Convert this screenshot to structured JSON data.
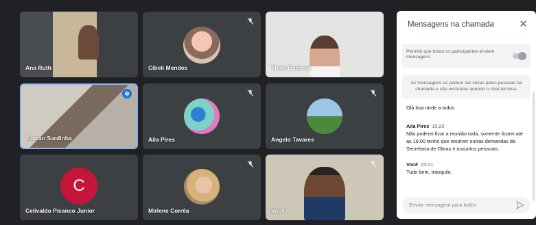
{
  "participants": [
    {
      "name": "Ana Ruth",
      "muted": false
    },
    {
      "name": "Cibeli Mendes",
      "muted": true
    },
    {
      "name": "Thais Barbosa",
      "muted": false
    },
    {
      "name": "Lorran Sardinha",
      "muted": false,
      "speaking": true
    },
    {
      "name": "Aila Pires",
      "muted": true
    },
    {
      "name": "Angelo Tavares",
      "muted": true
    },
    {
      "name": "Celivaldo Picanco Junior",
      "muted": false,
      "initial": "C"
    },
    {
      "name": "Mirlene Corrêa",
      "muted": true
    },
    {
      "name": "Você",
      "muted": true
    }
  ],
  "chat": {
    "title": "Mensagens na chamada",
    "allow_label": "Permitir que todos os participantes enviem mensagens",
    "info": "As mensagens só podem ser vistas pelas pessoas na chamada e são excluídas quando o chat termina.",
    "messages": [
      {
        "sender": "",
        "time": "",
        "text": "Olá boa tarde a todos"
      },
      {
        "sender": "Aila Pires",
        "time": "15:20",
        "text": "Não poderei ficar a reunião toda, somente ficarei até as 16:00 tenho que resolver outras demandas da Secretaria de Obras e  assuntos pessoais."
      },
      {
        "sender": "Você",
        "time": "15:21",
        "text": "Tudo bem, tranquilo."
      }
    ],
    "input_placeholder": "Enviar mensagem para todos"
  },
  "colors": {
    "tile_bg": "#3c4043",
    "speaking": "#1a73e8",
    "avatar_c": "#c5153b"
  }
}
